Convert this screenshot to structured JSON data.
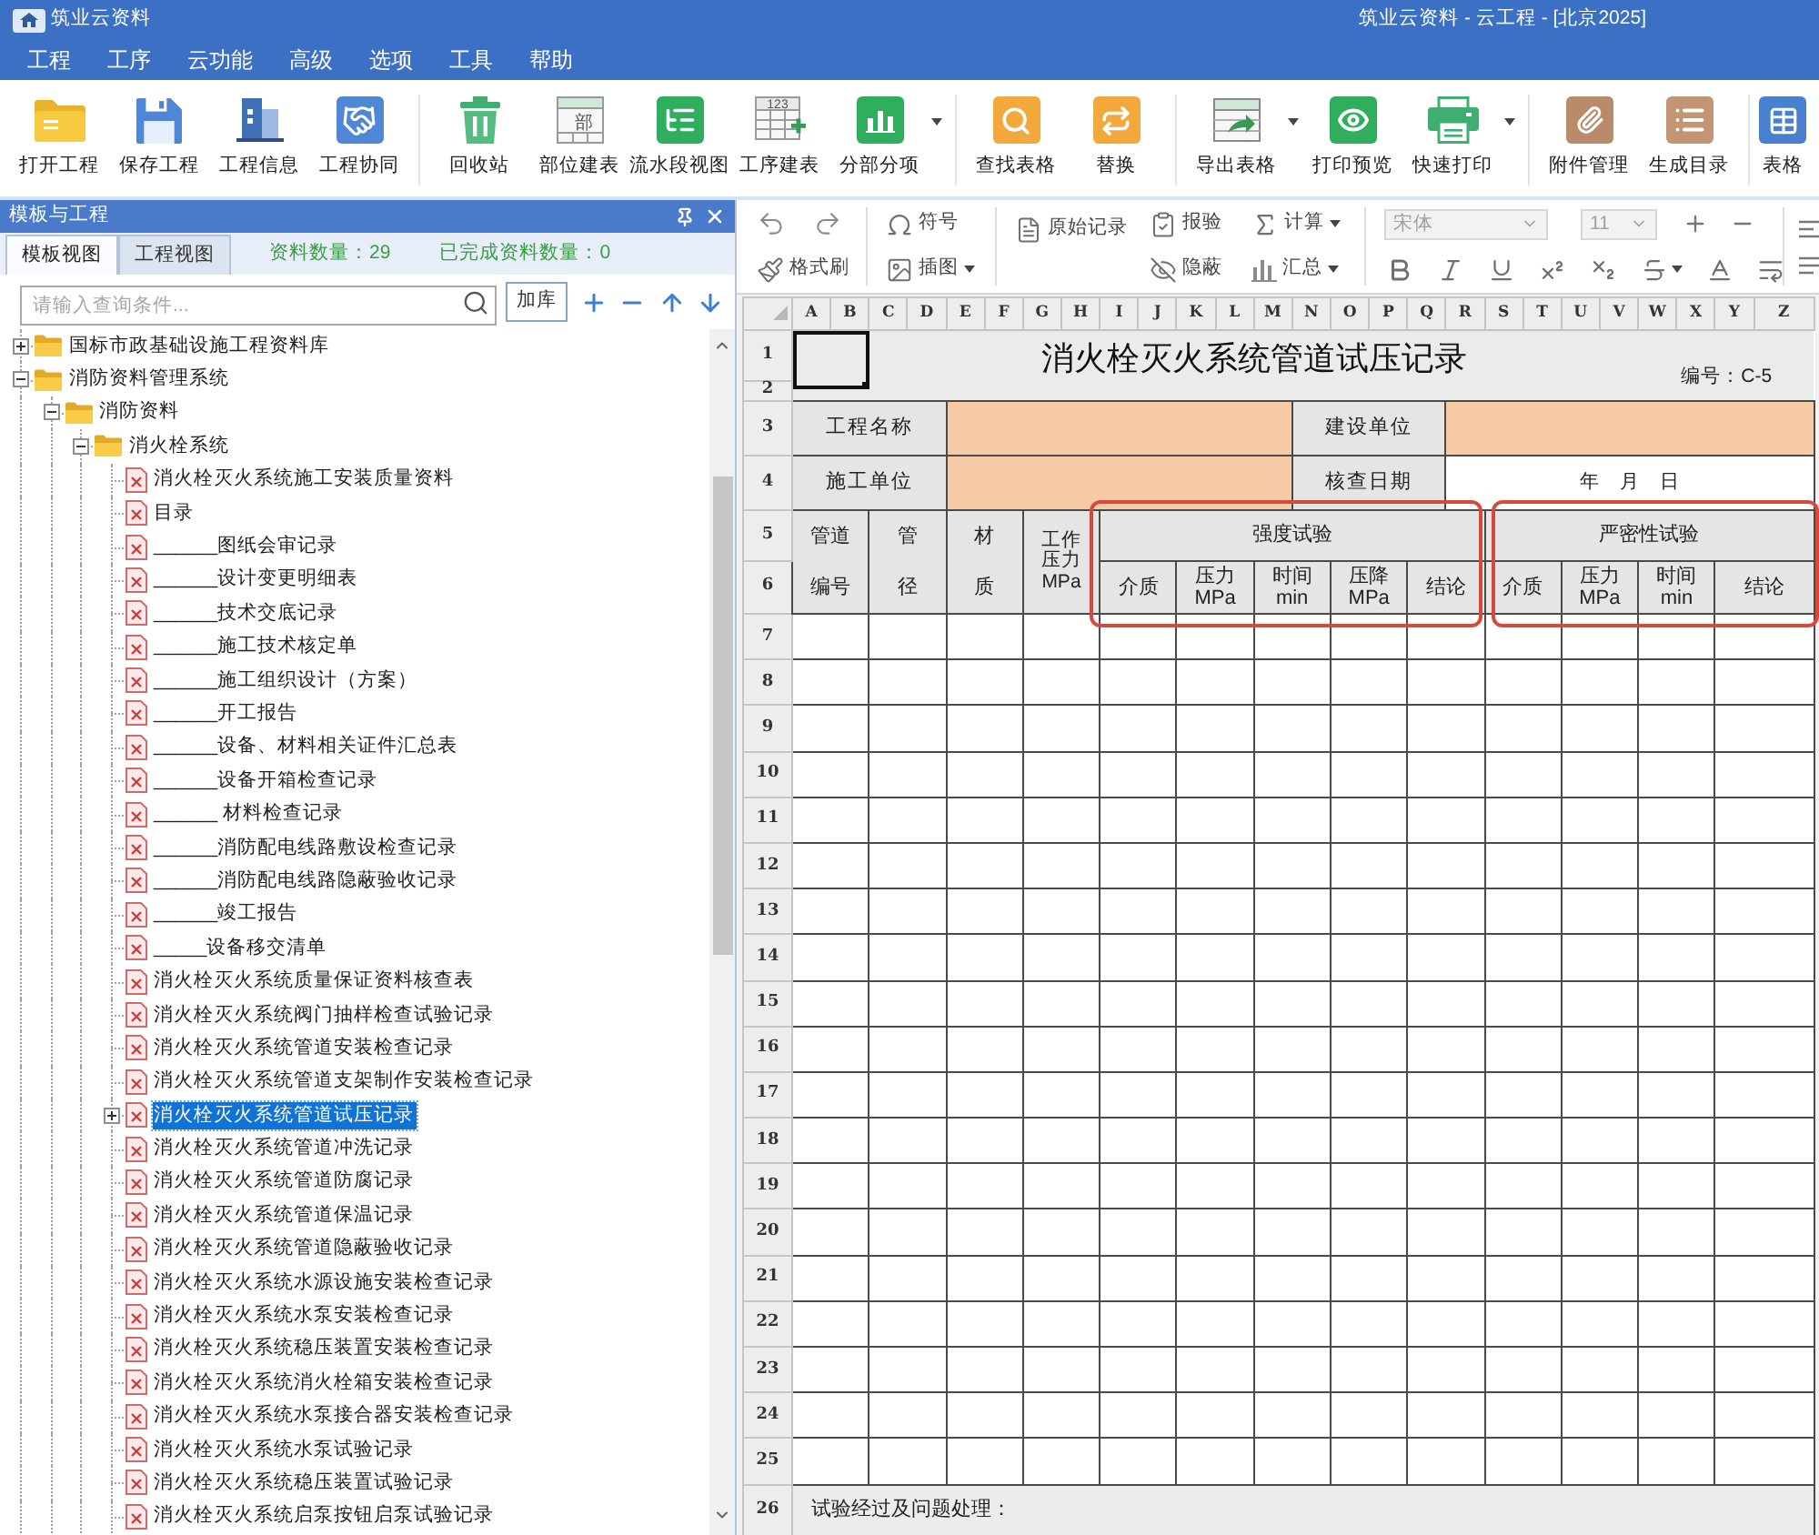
{
  "window": {
    "app_name": "筑业云资料",
    "title": "筑业云资料 - 云工程 - [北京2025]"
  },
  "menu": [
    "工程",
    "工序",
    "云功能",
    "高级",
    "选项",
    "工具",
    "帮助"
  ],
  "toolbar": [
    [
      {
        "label": "打开工程"
      },
      {
        "label": "保存工程"
      },
      {
        "label": "工程信息"
      },
      {
        "label": "工程协同"
      }
    ],
    [
      {
        "label": "回收站"
      },
      {
        "label": "部位建表",
        "icon_text": "部"
      },
      {
        "label": "流水段视图"
      },
      {
        "label": "工序建表",
        "icon_text": "123"
      },
      {
        "label": "分部分项",
        "dropdown": true
      }
    ],
    [
      {
        "label": "查找表格"
      },
      {
        "label": "替换"
      }
    ],
    [
      {
        "label": "导出表格",
        "dropdown": true
      },
      {
        "label": "打印预览"
      },
      {
        "label": "快速打印",
        "dropdown": true
      }
    ],
    [
      {
        "label": "附件管理"
      },
      {
        "label": "生成目录"
      }
    ],
    [
      {
        "label": "表格"
      }
    ]
  ],
  "panel": {
    "title": "模板与工程",
    "tabs": [
      {
        "label": "模板视图",
        "selected": true
      },
      {
        "label": "工程视图",
        "selected": false
      }
    ],
    "stats": [
      "资料数量：29",
      "已完成资料数量：0"
    ],
    "search": {
      "placeholder": "请输入查询条件..."
    },
    "add_library_button": "加库",
    "tree": [
      {
        "label": "国标市政基础设施工程资料库",
        "kind": "folder",
        "expanded": false,
        "selected": false
      },
      {
        "label": "消防资料管理系统",
        "kind": "folder",
        "expanded": true,
        "selected": false,
        "children": [
          {
            "label": "消防资料",
            "kind": "folder",
            "expanded": true,
            "selected": false,
            "children": [
              {
                "label": "消火栓系统",
                "kind": "folder",
                "expanded": true,
                "selected": false,
                "children": [
                  {
                    "label": "消火栓灭火系统施工安装质量资料",
                    "kind": "document",
                    "selected": false
                  },
                  {
                    "label": "目录",
                    "kind": "document",
                    "selected": false
                  },
                  {
                    "label": "______图纸会审记录",
                    "kind": "document",
                    "selected": false
                  },
                  {
                    "label": "______设计变更明细表",
                    "kind": "document",
                    "selected": false
                  },
                  {
                    "label": "______技术交底记录",
                    "kind": "document",
                    "selected": false
                  },
                  {
                    "label": "______施工技术核定单",
                    "kind": "document",
                    "selected": false
                  },
                  {
                    "label": "______施工组织设计（方案）",
                    "kind": "document",
                    "selected": false
                  },
                  {
                    "label": "______开工报告",
                    "kind": "document",
                    "selected": false
                  },
                  {
                    "label": "______设备、材料相关证件汇总表",
                    "kind": "document",
                    "selected": false
                  },
                  {
                    "label": "______设备开箱检查记录",
                    "kind": "document",
                    "selected": false
                  },
                  {
                    "label": "______ 材料检查记录",
                    "kind": "document",
                    "selected": false
                  },
                  {
                    "label": "______消防配电线路敷设检查记录",
                    "kind": "document",
                    "selected": false
                  },
                  {
                    "label": "______消防配电线路隐蔽验收记录",
                    "kind": "document",
                    "selected": false
                  },
                  {
                    "label": "______竣工报告",
                    "kind": "document",
                    "selected": false
                  },
                  {
                    "label": "_____设备移交清单",
                    "kind": "document",
                    "selected": false
                  },
                  {
                    "label": "消火栓灭火系统质量保证资料核查表",
                    "kind": "document",
                    "selected": false
                  },
                  {
                    "label": "消火栓灭火系统阀门抽样检查试验记录",
                    "kind": "document",
                    "selected": false
                  },
                  {
                    "label": "消火栓灭火系统管道安装检查记录",
                    "kind": "document",
                    "selected": false
                  },
                  {
                    "label": "消火栓灭火系统管道支架制作安装检查记录",
                    "kind": "document",
                    "selected": false
                  },
                  {
                    "label": "消火栓灭火系统管道试压记录",
                    "kind": "document",
                    "expanded": false,
                    "selected": true
                  },
                  {
                    "label": "消火栓灭火系统管道冲洗记录",
                    "kind": "document",
                    "selected": false
                  },
                  {
                    "label": "消火栓灭火系统管道防腐记录",
                    "kind": "document",
                    "selected": false
                  },
                  {
                    "label": "消火栓灭火系统管道保温记录",
                    "kind": "document",
                    "selected": false
                  },
                  {
                    "label": "消火栓灭火系统管道隐蔽验收记录",
                    "kind": "document",
                    "selected": false
                  },
                  {
                    "label": "消火栓灭火系统水源设施安装检查记录",
                    "kind": "document",
                    "selected": false
                  },
                  {
                    "label": "消火栓灭火系统水泵安装检查记录",
                    "kind": "document",
                    "selected": false
                  },
                  {
                    "label": "消火栓灭火系统稳压装置安装检查记录",
                    "kind": "document",
                    "selected": false
                  },
                  {
                    "label": "消火栓灭火系统消火栓箱安装检查记录",
                    "kind": "document",
                    "selected": false
                  },
                  {
                    "label": "消火栓灭火系统水泵接合器安装检查记录",
                    "kind": "document",
                    "selected": false
                  },
                  {
                    "label": "消火栓灭火系统水泵试验记录",
                    "kind": "document",
                    "selected": false
                  },
                  {
                    "label": "消火栓灭火系统稳压装置试验记录",
                    "kind": "document",
                    "selected": false
                  },
                  {
                    "label": "消火栓灭火系统启泵按钮启泵试验记录",
                    "kind": "document",
                    "selected": false
                  }
                ]
              }
            ]
          }
        ]
      }
    ]
  },
  "edit_toolbar": {
    "symbol": {
      "label": "符号"
    },
    "format_painter": {
      "label": "格式刷"
    },
    "insert_image": {
      "label": "插图",
      "dropdown": true
    },
    "raw_record": {
      "label": "原始记录"
    },
    "inspection": {
      "label": "报验"
    },
    "concealed": {
      "label": "隐蔽"
    },
    "calculate": {
      "label": "计算",
      "dropdown": true
    },
    "summary": {
      "label": "汇总",
      "dropdown": true
    },
    "font": {
      "value": "宋体",
      "disabled": true
    },
    "font_size": {
      "value": "11",
      "disabled": true
    }
  },
  "sheet": {
    "columns": [
      "A",
      "B",
      "C",
      "D",
      "E",
      "F",
      "G",
      "H",
      "I",
      "J",
      "K",
      "L",
      "M",
      "N",
      "O",
      "P",
      "Q",
      "R",
      "S",
      "T",
      "U",
      "V",
      "W",
      "X",
      "Y",
      "Z"
    ],
    "rows": [
      "1",
      "2",
      "3",
      "4",
      "5",
      "6",
      "7",
      "8",
      "9",
      "10",
      "11",
      "12",
      "13",
      "14",
      "15",
      "16",
      "17",
      "18",
      "19",
      "20",
      "21",
      "22",
      "23",
      "24",
      "25",
      "26"
    ],
    "first_cell": {
      "selected": true
    },
    "title": "消火栓灭火系统管道试压记录",
    "form_number": "编号：C-5",
    "info": [
      {
        "label": "工程名称"
      },
      {
        "label": "建设单位"
      },
      {
        "label": "施工单位"
      },
      {
        "label": "核查日期",
        "value": "年　月　日"
      }
    ],
    "fixed_columns": [
      "管道编号",
      "管径",
      "材质",
      "工作压力MPa"
    ],
    "strength_test": {
      "title": "强度试验",
      "highlighted": true,
      "columns": [
        "介质",
        "压力\nMPa",
        "时间\nmin",
        "压降\nMPa",
        "结论"
      ]
    },
    "tightness_test": {
      "title": "严密性试验",
      "highlighted": true,
      "columns": [
        "介质",
        "压力\nMPa",
        "时间\nmin",
        "结论"
      ]
    },
    "remarks_label": "试验经过及问题处理："
  }
}
